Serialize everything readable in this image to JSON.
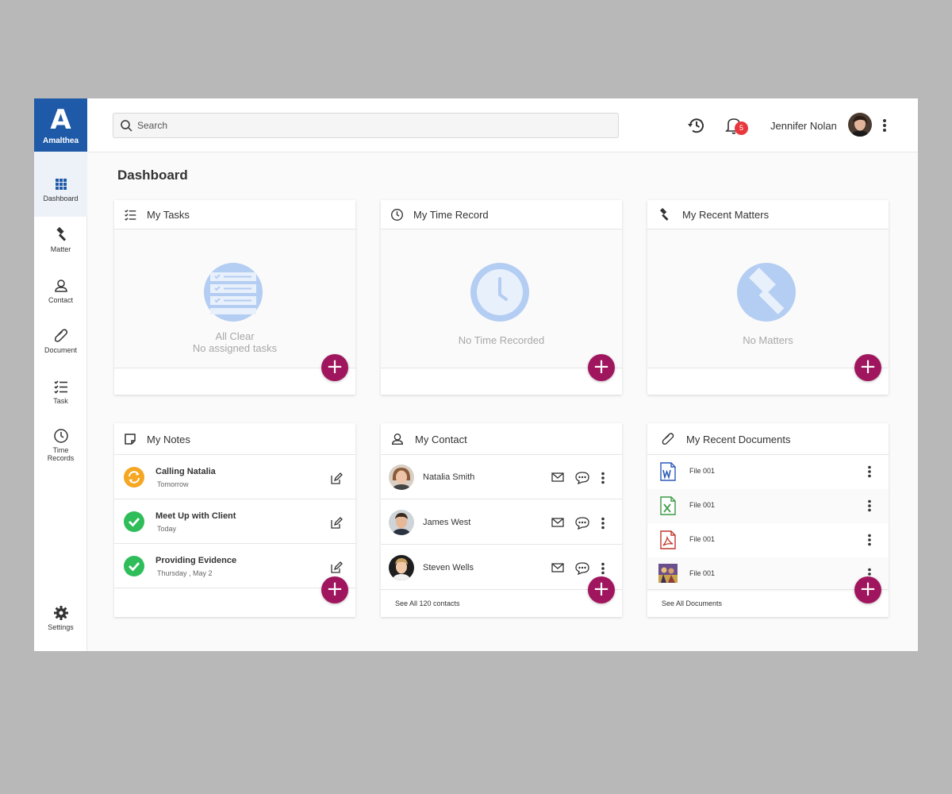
{
  "brand": {
    "letter": "A",
    "name": "Amalthea"
  },
  "sidebar": {
    "items": [
      {
        "label": "Dashboard"
      },
      {
        "label": "Matter"
      },
      {
        "label": "Contact"
      },
      {
        "label": "Document"
      },
      {
        "label": "Task"
      },
      {
        "label": "Time Records"
      }
    ],
    "settings": "Settings"
  },
  "header": {
    "search_placeholder": "Search",
    "notification_count": "5",
    "user_name": "Jennifer Nolan"
  },
  "page_title": "Dashboard",
  "cards": {
    "tasks": {
      "title": "My Tasks",
      "empty_line1": "All Clear",
      "empty_line2": "No assigned tasks"
    },
    "time": {
      "title": "My Time Record",
      "empty": "No Time Recorded"
    },
    "matters": {
      "title": "My Recent Matters",
      "empty": "No Matters"
    },
    "notes": {
      "title": "My Notes",
      "items": [
        {
          "title": "Calling Natalia",
          "when": "Tomorrow",
          "status": "pending"
        },
        {
          "title": "Meet Up with Client",
          "when": "Today",
          "status": "done"
        },
        {
          "title": "Providing Evidence",
          "when": "Thursday , May 2",
          "status": "done"
        }
      ]
    },
    "contacts": {
      "title": "My Contact",
      "items": [
        {
          "name": "Natalia Smith"
        },
        {
          "name": "James West"
        },
        {
          "name": "Steven Wells"
        }
      ],
      "see_all": "See All 120 contacts"
    },
    "documents": {
      "title": "My Recent Documents",
      "items": [
        {
          "name": "File 001",
          "type": "word-file-icon"
        },
        {
          "name": "File 001",
          "type": "excel-file-icon"
        },
        {
          "name": "File 001",
          "type": "pdf-file-icon"
        },
        {
          "name": "File 001",
          "type": "image-file-icon"
        }
      ],
      "see_all": "See All Documents"
    }
  },
  "colors": {
    "brand": "#1f5aa8",
    "fab": "#a0165e",
    "badge": "#e8383d",
    "done": "#2ebd59",
    "pending": "#f5a623",
    "illustration": "#b4cdf2"
  }
}
